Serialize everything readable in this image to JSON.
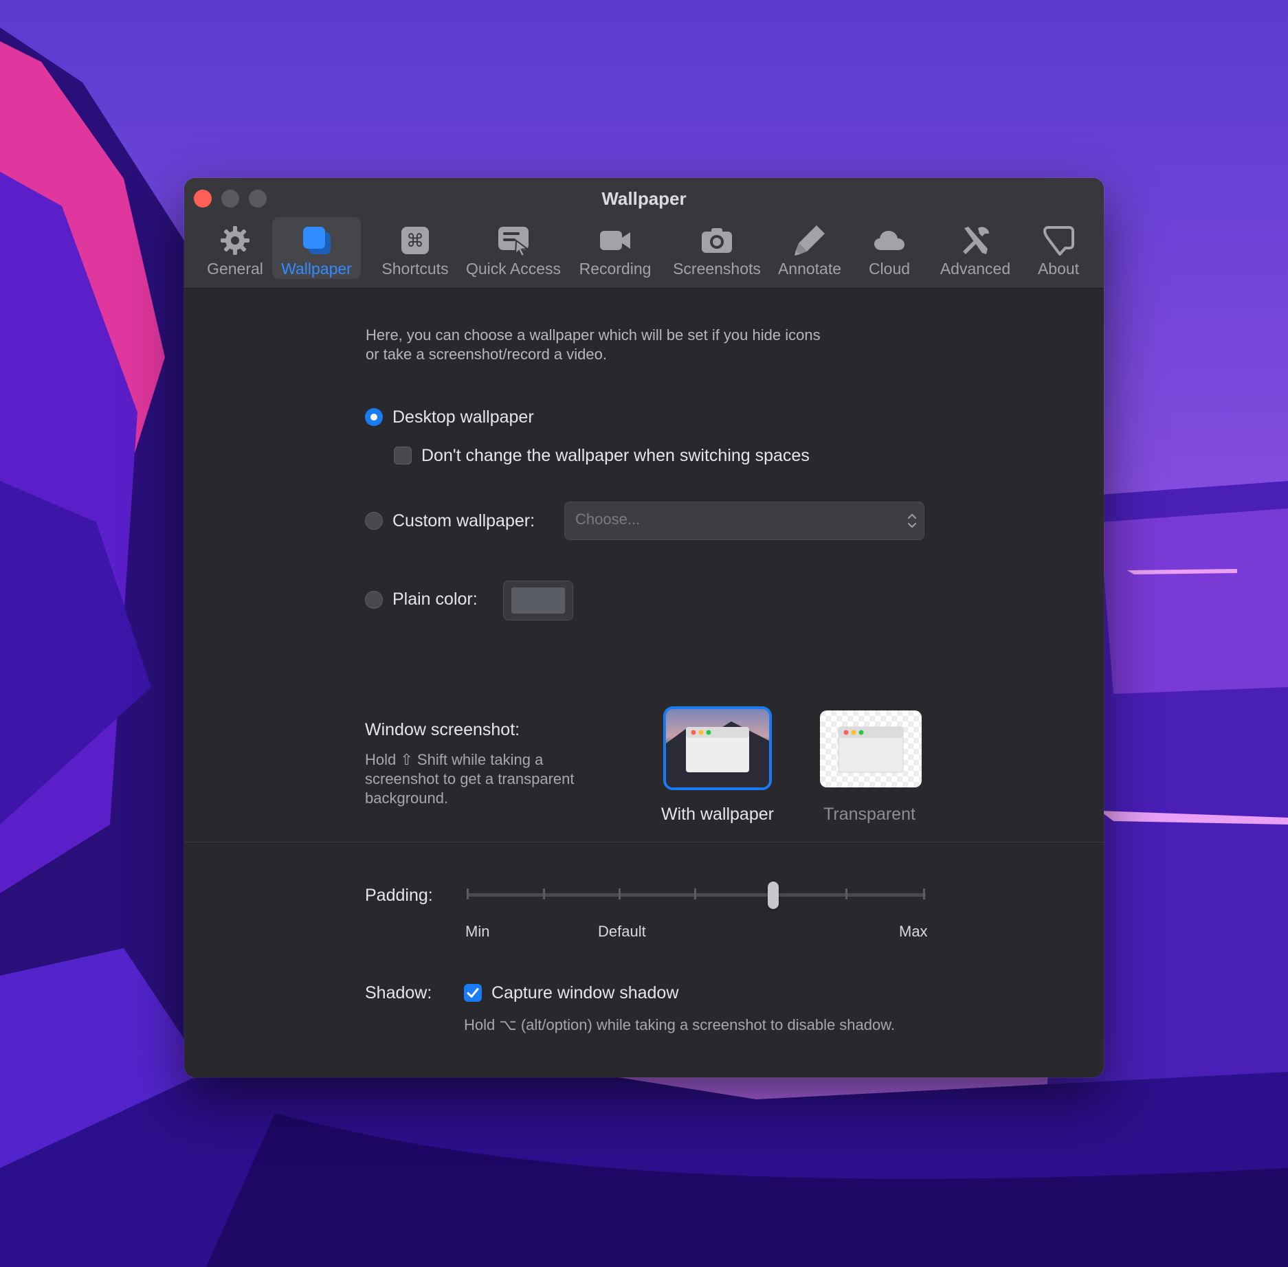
{
  "window": {
    "title": "Wallpaper"
  },
  "tabs": [
    {
      "id": "general",
      "label": "General",
      "icon": "gear-icon"
    },
    {
      "id": "wallpaper",
      "label": "Wallpaper",
      "icon": "wallpaper-icon",
      "active": true
    },
    {
      "id": "shortcuts",
      "label": "Shortcuts",
      "icon": "command-key-icon"
    },
    {
      "id": "quick-access",
      "label": "Quick Access",
      "icon": "quick-access-icon"
    },
    {
      "id": "recording",
      "label": "Recording",
      "icon": "video-camera-icon"
    },
    {
      "id": "screenshots",
      "label": "Screenshots",
      "icon": "camera-icon"
    },
    {
      "id": "annotate",
      "label": "Annotate",
      "icon": "highlighter-icon"
    },
    {
      "id": "cloud",
      "label": "Cloud",
      "icon": "cloud-icon"
    },
    {
      "id": "advanced",
      "label": "Advanced",
      "icon": "tools-icon"
    },
    {
      "id": "about",
      "label": "About",
      "icon": "about-icon"
    }
  ],
  "wallpaper": {
    "intro": "Here, you can choose a wallpaper which will be set if you hide icons\nor take a screenshot/record a video.",
    "desktop_label": "Desktop wallpaper",
    "desktop_selected": true,
    "dont_change_label": "Don't change the wallpaper when switching spaces",
    "dont_change_checked": false,
    "custom_label": "Custom wallpaper:",
    "custom_placeholder": "Choose...",
    "plain_label": "Plain color:",
    "plain_color": "#5a5d66"
  },
  "window_screenshot": {
    "label": "Window screenshot:",
    "help_line1": "Hold ⇧ Shift while taking a",
    "help_line2": "screenshot to get a transparent",
    "help_line3": "background.",
    "option_with": "With wallpaper",
    "option_transparent": "Transparent",
    "selected": "With wallpaper"
  },
  "padding": {
    "label": "Padding:",
    "min_label": "Min",
    "default_label": "Default",
    "max_label": "Max",
    "value_fraction": 0.667
  },
  "shadow": {
    "label": "Shadow:",
    "capture_label": "Capture window shadow",
    "capture_checked": true,
    "help": "Hold ⌥ (alt/option) while taking a screenshot to disable shadow."
  },
  "colors": {
    "accent": "#1a7cf5",
    "window_bg": "#29282c",
    "toolbar_bg": "#38373b",
    "close": "#ff5f57"
  }
}
